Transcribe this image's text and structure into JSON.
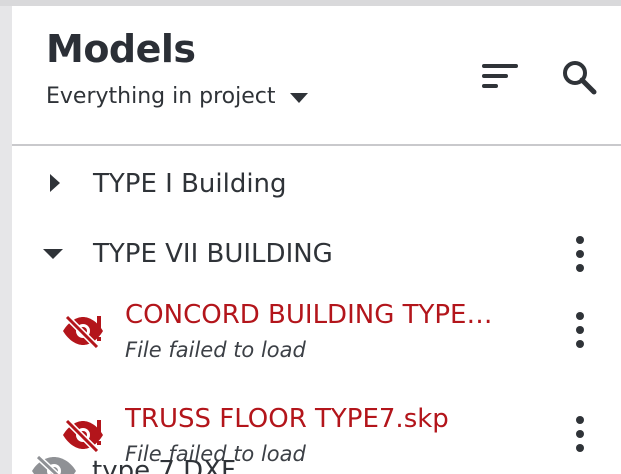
{
  "header": {
    "title": "Models",
    "scope_selector": "Everything in project",
    "sort_label": "Sort",
    "search_label": "Search"
  },
  "tree": {
    "groups": [
      {
        "label": "TYPE I Building",
        "expanded": false
      },
      {
        "label": "TYPE VII BUILDING",
        "expanded": true
      }
    ],
    "models": [
      {
        "name": "CONCORD BUILDING TYPE…",
        "status": "File failed to load",
        "status_color": "#b3151b"
      },
      {
        "name": "TRUSS FLOOR TYPE7.skp",
        "status": "File failed to load",
        "status_color": "#b3151b"
      }
    ],
    "partial_item": {
      "name": "type 7 DXF"
    }
  },
  "colors": {
    "error_red": "#b3151b",
    "text_dark": "#2f3338",
    "divider": "#c9c9cc"
  },
  "icons": {
    "sort": "sort-icon",
    "search": "search-icon",
    "failed": "eye-slash-warning-icon",
    "hidden": "eye-slash-icon",
    "more": "more-vertical-icon"
  }
}
